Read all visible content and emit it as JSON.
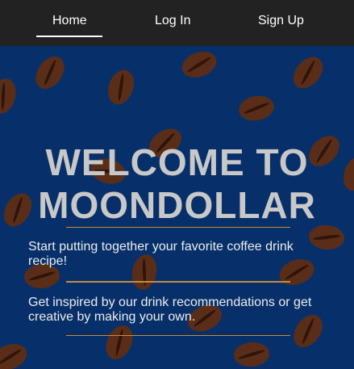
{
  "nav": {
    "items": [
      {
        "label": "Home",
        "active": true
      },
      {
        "label": "Log In",
        "active": false
      },
      {
        "label": "Sign Up",
        "active": false
      }
    ]
  },
  "hero": {
    "title_line1": "WELCOME TO",
    "title_line2": "MOONDOLLAR",
    "text1": "Start putting together your favorite coffee drink recipe!",
    "text2": "Get inspired by our drink recommendations or get creative by making your own."
  },
  "colors": {
    "navbar": "#222222",
    "background": "#07306a",
    "bean": "#5a2d18",
    "rule": "#c98a3a"
  }
}
